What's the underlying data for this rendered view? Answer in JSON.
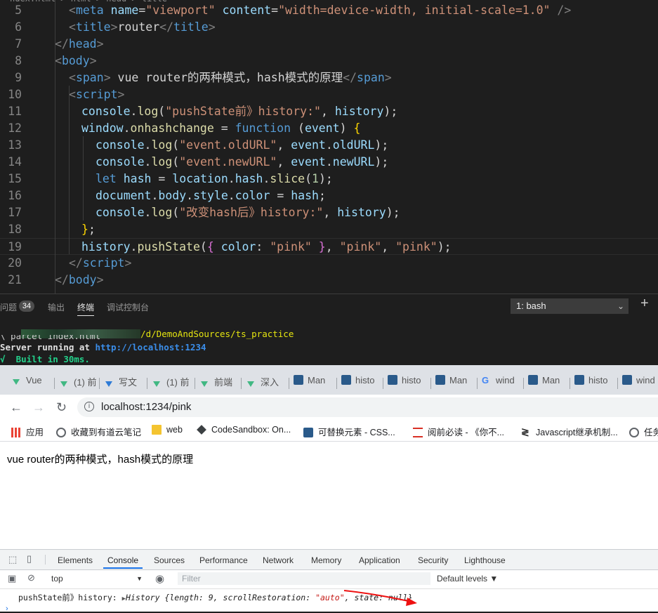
{
  "editor": {
    "header_partial": "ndex.html > html > head > title",
    "line_numbers": [
      "5",
      "6",
      "7",
      "8",
      "9",
      "10",
      "11",
      "12",
      "13",
      "14",
      "15",
      "16",
      "17",
      "18",
      "19",
      "20",
      "21"
    ],
    "lines": [
      [
        {
          "t": "<",
          "c": "t-br"
        },
        {
          "t": "meta",
          "c": "t-tag"
        },
        {
          "t": " name",
          "c": "t-attr"
        },
        {
          "t": "=",
          "c": "t-txt"
        },
        {
          "t": "\"viewport\"",
          "c": "t-str"
        },
        {
          "t": " content",
          "c": "t-attr"
        },
        {
          "t": "=",
          "c": "t-txt"
        },
        {
          "t": "\"width=device-width, initial-scale=1.0\"",
          "c": "t-str"
        },
        {
          "t": " />",
          "c": "t-br"
        }
      ],
      [
        {
          "t": "<",
          "c": "t-br"
        },
        {
          "t": "title",
          "c": "t-tag"
        },
        {
          "t": ">",
          "c": "t-br"
        },
        {
          "t": "router",
          "c": "t-txt"
        },
        {
          "t": "</",
          "c": "t-br"
        },
        {
          "t": "title",
          "c": "t-tag"
        },
        {
          "t": ">",
          "c": "t-br"
        }
      ],
      [
        {
          "t": "</",
          "c": "t-br"
        },
        {
          "t": "head",
          "c": "t-tag"
        },
        {
          "t": ">",
          "c": "t-br"
        }
      ],
      [
        {
          "t": "<",
          "c": "t-br"
        },
        {
          "t": "body",
          "c": "t-tag"
        },
        {
          "t": ">",
          "c": "t-br"
        }
      ],
      [
        {
          "t": "<",
          "c": "t-br"
        },
        {
          "t": "span",
          "c": "t-tag"
        },
        {
          "t": ">",
          "c": "t-br"
        },
        {
          "t": " vue router的两种模式，hash模式的原理",
          "c": "t-txt"
        },
        {
          "t": "</",
          "c": "t-br"
        },
        {
          "t": "span",
          "c": "t-tag"
        },
        {
          "t": ">",
          "c": "t-br"
        }
      ],
      [
        {
          "t": "<",
          "c": "t-br"
        },
        {
          "t": "script",
          "c": "t-tag"
        },
        {
          "t": ">",
          "c": "t-br"
        }
      ],
      [
        {
          "t": "console",
          "c": "t-id"
        },
        {
          "t": ".",
          "c": "t-txt"
        },
        {
          "t": "log",
          "c": "t-fn"
        },
        {
          "t": "(",
          "c": "t-txt"
        },
        {
          "t": "\"pushState前》history:\"",
          "c": "t-str"
        },
        {
          "t": ", ",
          "c": "t-txt"
        },
        {
          "t": "history",
          "c": "t-id"
        },
        {
          "t": ");",
          "c": "t-txt"
        }
      ],
      [
        {
          "t": "window",
          "c": "t-id"
        },
        {
          "t": ".",
          "c": "t-txt"
        },
        {
          "t": "onhashchange",
          "c": "t-fn"
        },
        {
          "t": " = ",
          "c": "t-txt"
        },
        {
          "t": "function",
          "c": "t-kw"
        },
        {
          "t": " (",
          "c": "t-txt"
        },
        {
          "t": "event",
          "c": "t-id"
        },
        {
          "t": ") ",
          "c": "t-txt"
        },
        {
          "t": "{",
          "c": "t-b1"
        }
      ],
      [
        {
          "t": "console",
          "c": "t-id"
        },
        {
          "t": ".",
          "c": "t-txt"
        },
        {
          "t": "log",
          "c": "t-fn"
        },
        {
          "t": "(",
          "c": "t-txt"
        },
        {
          "t": "\"event.oldURL\"",
          "c": "t-str"
        },
        {
          "t": ", ",
          "c": "t-txt"
        },
        {
          "t": "event",
          "c": "t-id"
        },
        {
          "t": ".",
          "c": "t-txt"
        },
        {
          "t": "oldURL",
          "c": "t-id"
        },
        {
          "t": ");",
          "c": "t-txt"
        }
      ],
      [
        {
          "t": "console",
          "c": "t-id"
        },
        {
          "t": ".",
          "c": "t-txt"
        },
        {
          "t": "log",
          "c": "t-fn"
        },
        {
          "t": "(",
          "c": "t-txt"
        },
        {
          "t": "\"event.newURL\"",
          "c": "t-str"
        },
        {
          "t": ", ",
          "c": "t-txt"
        },
        {
          "t": "event",
          "c": "t-id"
        },
        {
          "t": ".",
          "c": "t-txt"
        },
        {
          "t": "newURL",
          "c": "t-id"
        },
        {
          "t": ");",
          "c": "t-txt"
        }
      ],
      [
        {
          "t": "let",
          "c": "t-kw"
        },
        {
          "t": " hash",
          "c": "t-id"
        },
        {
          "t": " = ",
          "c": "t-txt"
        },
        {
          "t": "location",
          "c": "t-id"
        },
        {
          "t": ".",
          "c": "t-txt"
        },
        {
          "t": "hash",
          "c": "t-id"
        },
        {
          "t": ".",
          "c": "t-txt"
        },
        {
          "t": "slice",
          "c": "t-fn"
        },
        {
          "t": "(",
          "c": "t-txt"
        },
        {
          "t": "1",
          "c": "t-num"
        },
        {
          "t": ");",
          "c": "t-txt"
        }
      ],
      [
        {
          "t": "document",
          "c": "t-id"
        },
        {
          "t": ".",
          "c": "t-txt"
        },
        {
          "t": "body",
          "c": "t-id"
        },
        {
          "t": ".",
          "c": "t-txt"
        },
        {
          "t": "style",
          "c": "t-id"
        },
        {
          "t": ".",
          "c": "t-txt"
        },
        {
          "t": "color",
          "c": "t-id"
        },
        {
          "t": " = ",
          "c": "t-txt"
        },
        {
          "t": "hash",
          "c": "t-id"
        },
        {
          "t": ";",
          "c": "t-txt"
        }
      ],
      [
        {
          "t": "console",
          "c": "t-id"
        },
        {
          "t": ".",
          "c": "t-txt"
        },
        {
          "t": "log",
          "c": "t-fn"
        },
        {
          "t": "(",
          "c": "t-txt"
        },
        {
          "t": "\"改变hash后》history:\"",
          "c": "t-str"
        },
        {
          "t": ", ",
          "c": "t-txt"
        },
        {
          "t": "history",
          "c": "t-id"
        },
        {
          "t": ");",
          "c": "t-txt"
        }
      ],
      [
        {
          "t": "}",
          "c": "t-b1"
        },
        {
          "t": ";",
          "c": "t-txt"
        }
      ],
      [
        {
          "t": "history",
          "c": "t-id"
        },
        {
          "t": ".",
          "c": "t-txt"
        },
        {
          "t": "pushState",
          "c": "t-fn"
        },
        {
          "t": "(",
          "c": "t-txt"
        },
        {
          "t": "{",
          "c": "t-b2"
        },
        {
          "t": " color",
          "c": "t-id"
        },
        {
          "t": ": ",
          "c": "t-txt"
        },
        {
          "t": "\"pink\"",
          "c": "t-str"
        },
        {
          "t": " ",
          "c": "t-txt"
        },
        {
          "t": "}",
          "c": "t-b2"
        },
        {
          "t": ", ",
          "c": "t-txt"
        },
        {
          "t": "\"pink\"",
          "c": "t-str"
        },
        {
          "t": ", ",
          "c": "t-txt"
        },
        {
          "t": "\"pink\"",
          "c": "t-str"
        },
        {
          "t": ");",
          "c": "t-txt"
        }
      ],
      [
        {
          "t": "</",
          "c": "t-br"
        },
        {
          "t": "script",
          "c": "t-tag"
        },
        {
          "t": ">",
          "c": "t-br"
        }
      ],
      [
        {
          "t": "</",
          "c": "t-br"
        },
        {
          "t": "body",
          "c": "t-tag"
        },
        {
          "t": ">",
          "c": "t-br"
        }
      ]
    ]
  },
  "panel": {
    "tabs": {
      "problems": "问题",
      "problems_count": "34",
      "output": "输出",
      "terminal": "终端",
      "debug_console": "调试控制台"
    },
    "terminal_select": "1: bash",
    "add": "+",
    "terminal": {
      "path": "/d/DemoAndSources/ts_practice",
      "cmd": "\\ parcel index.html",
      "server_prefix": "Server running at ",
      "server_url": "http://localhost:1234",
      "built_prefix": "√",
      "built": "Built in 30ms."
    }
  },
  "browser": {
    "tabs": [
      "Vue",
      "(1) 前",
      "写文",
      "(1) 前",
      "前端",
      "深入",
      "Man",
      "histo",
      "histo",
      "Man",
      "wind",
      "Man",
      "histo",
      "wind"
    ],
    "url": "localhost:1234/pink",
    "bookmarks": [
      "应用",
      "收藏到有道云笔记",
      "web",
      "CodeSandbox: On...",
      "可替换元素 - CSS...",
      "阅前必读 - 《你不...",
      "Javascript继承机制...",
      "任务"
    ],
    "page_text": "vue router的两种模式，hash模式的原理"
  },
  "devtools": {
    "tabs": [
      "Elements",
      "Console",
      "Sources",
      "Performance",
      "Network",
      "Memory",
      "Application",
      "Security",
      "Lighthouse"
    ],
    "context": "top",
    "filter_placeholder": "Filter",
    "levels": "Default levels ▼",
    "console_prefix": "pushState前》history: ",
    "console_obj": "History {length: 9, scrollRestoration: \"auto\", state: null}"
  },
  "colors": {
    "editor_bg": "#1e1e1e",
    "terminal_green": "#23d18b",
    "terminal_blue": "#3b8eea",
    "accent": "#1a73e8",
    "annotation_arrow": "#ee1111"
  }
}
